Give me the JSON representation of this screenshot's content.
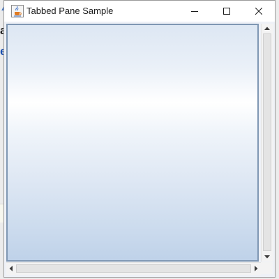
{
  "background_app": {
    "glyph_a": "a",
    "glyph_e": "e"
  },
  "window": {
    "title": "Tabbed Pane Sample",
    "icons": {
      "app": "java-cup-icon",
      "minimize": "minimize-icon",
      "maximize": "maximize-icon",
      "close": "close-icon"
    }
  },
  "colors": {
    "panel_border": "#7f97b3",
    "panel_gradient_top": "#dde7f3",
    "panel_gradient_highlight": "#ffffff",
    "panel_gradient_bottom": "#bfd2e9",
    "scrollbar_track": "#f3f3f3"
  },
  "scrollbars": {
    "vertical": {
      "up_icon": "arrow-up-icon",
      "down_icon": "arrow-down-icon"
    },
    "horizontal": {
      "left_icon": "arrow-left-icon",
      "right_icon": "arrow-right-icon"
    }
  }
}
